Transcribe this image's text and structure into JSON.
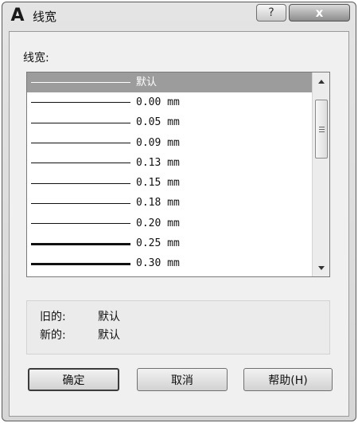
{
  "window": {
    "title": "线宽",
    "app_icon_glyph": "A",
    "help_glyph": "?",
    "close_glyph": "x"
  },
  "lineweight": {
    "label": "线宽:",
    "selected_index": 0,
    "items": [
      {
        "label": "默认",
        "weight_mm": null
      },
      {
        "label": "0.00 mm",
        "weight_mm": 0.0
      },
      {
        "label": "0.05 mm",
        "weight_mm": 0.05
      },
      {
        "label": "0.09 mm",
        "weight_mm": 0.09
      },
      {
        "label": "0.13 mm",
        "weight_mm": 0.13
      },
      {
        "label": "0.15 mm",
        "weight_mm": 0.15
      },
      {
        "label": "0.18 mm",
        "weight_mm": 0.18
      },
      {
        "label": "0.20 mm",
        "weight_mm": 0.2
      },
      {
        "label": "0.25 mm",
        "weight_mm": 0.25
      },
      {
        "label": "0.30 mm",
        "weight_mm": 0.3
      }
    ]
  },
  "info": {
    "old_label": "旧的:",
    "old_value": "默认",
    "new_label": "新的:",
    "new_value": "默认"
  },
  "buttons": {
    "ok": "确定",
    "cancel": "取消",
    "help": "帮助(H)"
  },
  "colors": {
    "selection": "#9c9c9c",
    "dialog_bg": "#f0f0f0"
  }
}
